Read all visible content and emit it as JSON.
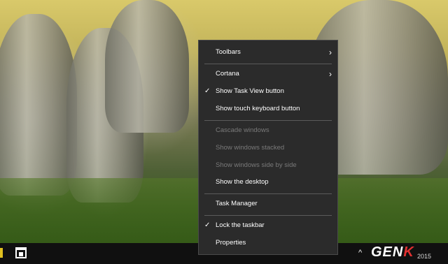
{
  "menu": {
    "toolbars": "Toolbars",
    "cortana": "Cortana",
    "show_task_view": "Show Task View button",
    "show_touch_keyboard": "Show touch keyboard button",
    "cascade": "Cascade windows",
    "stacked": "Show windows stacked",
    "side_by_side": "Show windows side by side",
    "show_desktop": "Show the desktop",
    "task_manager": "Task Manager",
    "lock_taskbar": "Lock the taskbar",
    "properties": "Properties",
    "check_glyph": "✓",
    "submenu_glyph": "›"
  },
  "taskbar": {
    "tray_chevron": "^",
    "clock_date": "2015"
  },
  "watermark": {
    "text_a": "GEN",
    "text_b": "K"
  }
}
